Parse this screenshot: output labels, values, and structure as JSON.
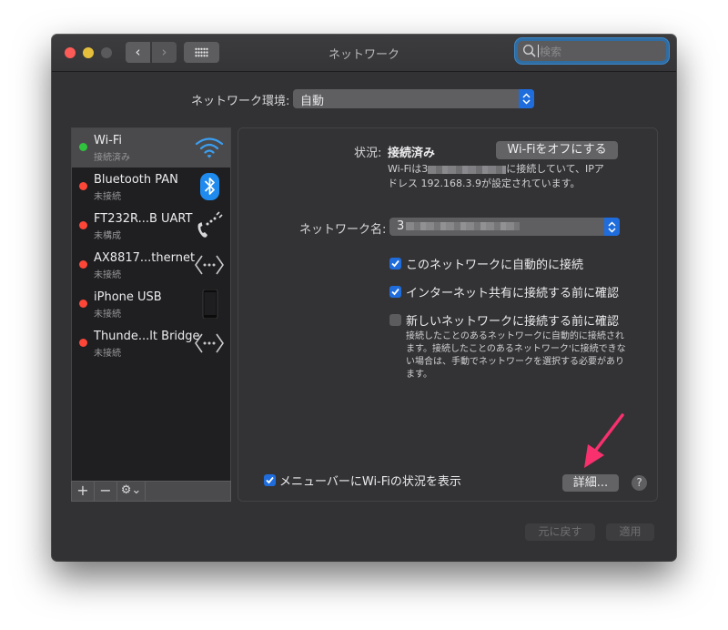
{
  "window": {
    "title": "ネットワーク",
    "search_placeholder": "検索",
    "nav_back": "‹",
    "nav_forward": "›"
  },
  "location": {
    "label": "ネットワーク環境:",
    "value": "自動"
  },
  "services": [
    {
      "name": "Wi-Fi",
      "status": "接続済み",
      "status_color": "#30c33d",
      "icon": "wifi-icon",
      "selected": true
    },
    {
      "name": "Bluetooth PAN",
      "status": "未接続",
      "status_color": "#fd4638",
      "icon": "bluetooth-icon",
      "selected": false
    },
    {
      "name": "FT232R...B UART",
      "status": "未構成",
      "status_color": "#fd4638",
      "icon": "phone-modem-icon",
      "selected": false
    },
    {
      "name": "AX8817...thernet",
      "status": "未接続",
      "status_color": "#fd4638",
      "icon": "ethernet-icon",
      "selected": false
    },
    {
      "name": "iPhone USB",
      "status": "未接続",
      "status_color": "#fd4638",
      "icon": "iphone-icon",
      "selected": false
    },
    {
      "name": "Thunde...lt Bridge",
      "status": "未接続",
      "status_color": "#fd4638",
      "icon": "ethernet-icon",
      "selected": false
    }
  ],
  "sidebar_toolbar": {
    "add": "+",
    "remove": "−",
    "gear": "⚙︎⌄"
  },
  "detail": {
    "status_label": "状況:",
    "status_value": "接続済み",
    "wifi_off_button": "Wi-Fiをオフにする",
    "status_desc_prefix": "Wi-Fiは3",
    "status_desc_mid": "に接続していて、IPア",
    "status_desc_line2": "ドレス 192.168.3.9が設定されています。",
    "network_name_label": "ネットワーク名:",
    "network_name_value": "3",
    "checkboxes": [
      {
        "label": "このネットワークに自動的に接続",
        "checked": true
      },
      {
        "label": "インターネット共有に接続する前に確認",
        "checked": true
      },
      {
        "label": "新しいネットワークに接続する前に確認",
        "checked": false
      }
    ],
    "new_network_desc": [
      "接続したことのあるネットワークに自動的に接続され",
      "ます。接続したことのあるネットワーク'に接続できな",
      "い場合は、手動でネットワークを選択する必要があり",
      "ます。"
    ],
    "menubar_checkbox": {
      "label": "メニューバーにWi-Fiの状況を表示",
      "checked": true
    },
    "advanced_button": "詳細...",
    "help": "?"
  },
  "footer": {
    "revert": "元に戻す",
    "apply": "適用"
  },
  "annotation": {
    "color": "#f8306e"
  }
}
